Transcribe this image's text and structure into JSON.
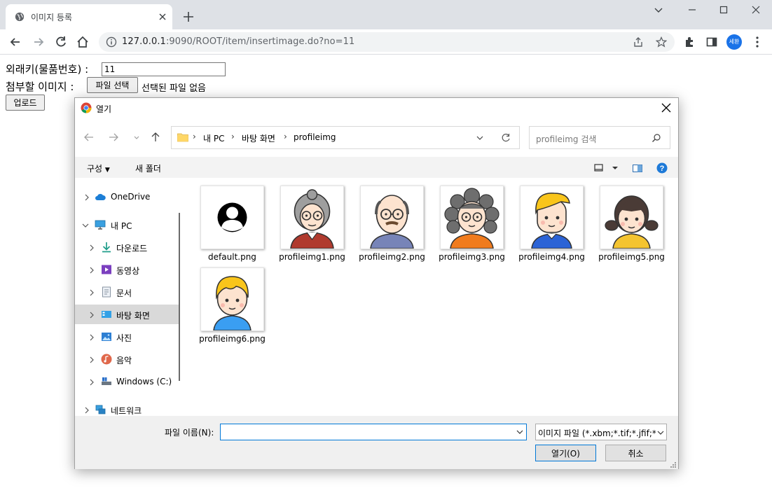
{
  "browser": {
    "tab_title": "이미지 등록",
    "url_host": "127.0.0.1",
    "url_rest": ":9090/ROOT/item/insertimage.do?no=11",
    "profile_initials": "세환"
  },
  "page": {
    "fk_label": "외래키(물품번호) :",
    "fk_value": "11",
    "attach_label": "첨부할 이미지 :",
    "file_button": "파일 선택",
    "file_status": "선택된 파일 없음",
    "upload_button": "업로드"
  },
  "dialog": {
    "title": "열기",
    "breadcrumb": [
      "내 PC",
      "바탕 화면",
      "profileimg"
    ],
    "search_placeholder": "profileimg 검색",
    "commands": {
      "organize": "구성",
      "new_folder": "새 폴더"
    },
    "nav": [
      {
        "label": "OneDrive",
        "icon": "cloud-icon"
      },
      {
        "label": "내 PC",
        "icon": "computer-icon"
      },
      {
        "label": "다운로드",
        "icon": "download-icon"
      },
      {
        "label": "동영상",
        "icon": "video-icon"
      },
      {
        "label": "문서",
        "icon": "document-icon"
      },
      {
        "label": "바탕 화면",
        "icon": "desktop-icon",
        "selected": true
      },
      {
        "label": "사진",
        "icon": "pictures-icon"
      },
      {
        "label": "음악",
        "icon": "music-icon"
      },
      {
        "label": "Windows (C:)",
        "icon": "drive-icon"
      },
      {
        "label": "네트워크",
        "icon": "network-icon"
      }
    ],
    "files": [
      "default.png",
      "profileimg1.png",
      "profileimg2.png",
      "profileimg3.png",
      "profileimg4.png",
      "profileimg5.png",
      "profileimg6.png"
    ],
    "filename_label": "파일 이름(N):",
    "filename_value": "",
    "filetype": "이미지 파일 (*.xbm;*.tif;*.jfif;*.i",
    "open_button": "열기(O)",
    "cancel_button": "취소"
  },
  "colors": {
    "accent": "#0078d7",
    "chrome_tabstrip": "#dee1e6",
    "profile_blue": "#1a73e8"
  }
}
